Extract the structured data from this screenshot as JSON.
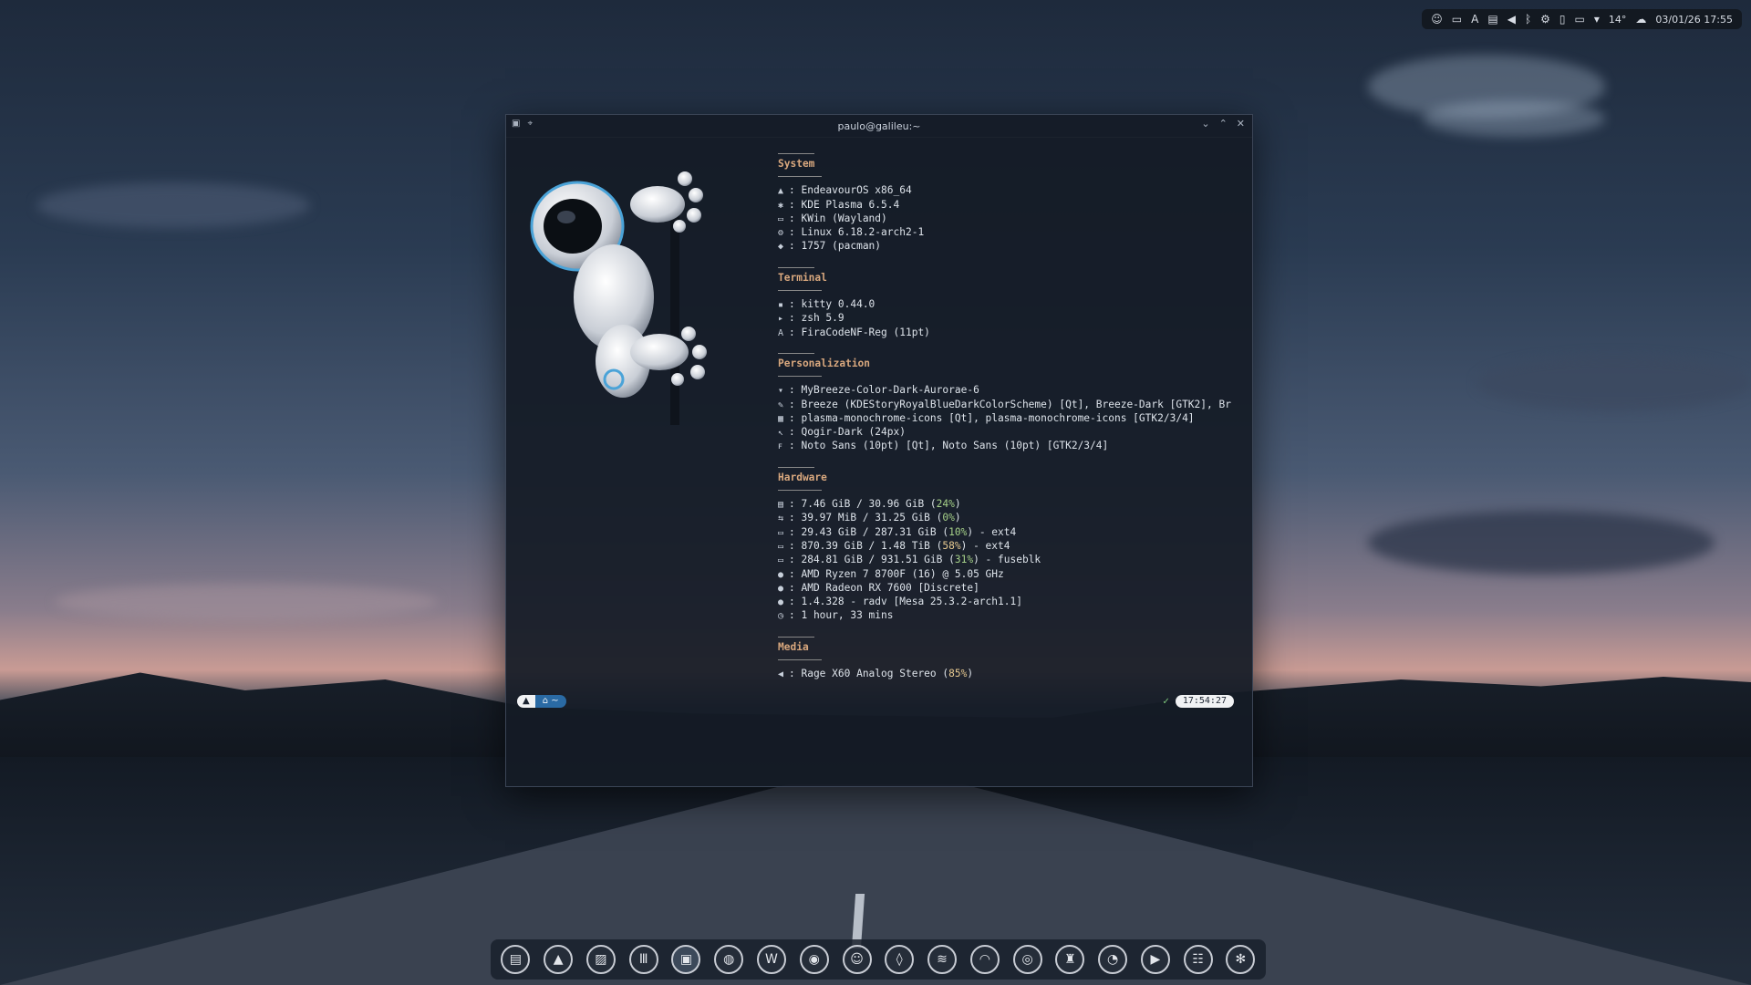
{
  "panel": {
    "icons": [
      "discord-icon",
      "battery-icon",
      "font-icon",
      "clipboard-icon",
      "volume-icon",
      "bluetooth-icon",
      "network-icon",
      "sd-card-icon",
      "display-icon",
      "chevron-down-icon"
    ],
    "weather_temp": "14°",
    "weather_icon": "cloud-icon",
    "datetime": "03/01/26 17:55"
  },
  "terminal": {
    "title": "paulo@galileu:~",
    "sections": [
      {
        "title": "System",
        "rows": [
          {
            "icon": "▲",
            "text": ": EndeavourOS x86_64"
          },
          {
            "icon": "✱",
            "text": ": KDE Plasma 6.5.4"
          },
          {
            "icon": "▭",
            "text": ": KWin (Wayland)"
          },
          {
            "icon": "⚙",
            "text": ": Linux 6.18.2-arch2-1"
          },
          {
            "icon": "◆",
            "text": ": 1757 (pacman)"
          }
        ]
      },
      {
        "title": "Terminal",
        "rows": [
          {
            "icon": "▪",
            "text": ": kitty 0.44.0"
          },
          {
            "icon": "▸",
            "text": ": zsh 5.9"
          },
          {
            "icon": "A",
            "text": ": FiraCodeNF-Reg (11pt)"
          }
        ]
      },
      {
        "title": "Personalization",
        "rows": [
          {
            "icon": "▾",
            "text": ": MyBreeze-Color-Dark-Aurorae-6"
          },
          {
            "icon": "✎",
            "text": ": Breeze (KDEStoryRoyalBlueDarkColorScheme) [Qt], Breeze-Dark [GTK2], Br"
          },
          {
            "icon": "▦",
            "text": ": plasma-monochrome-icons [Qt], plasma-monochrome-icons [GTK2/3/4]"
          },
          {
            "icon": "↖",
            "text": ": Qogir-Dark (24px)"
          },
          {
            "icon": "ꜰ",
            "text": ": Noto Sans (10pt) [Qt], Noto Sans (10pt) [GTK2/3/4]"
          }
        ]
      },
      {
        "title": "Hardware",
        "rows": [
          {
            "icon": "▤",
            "pre": ": 7.46 GiB / 30.96 GiB (",
            "pct": "24%",
            "post": ")",
            "warn": false
          },
          {
            "icon": "⇆",
            "pre": ": 39.97 MiB / 31.25 GiB (",
            "pct": "0%",
            "post": ")",
            "warn": false
          },
          {
            "icon": "▭",
            "pre": ": 29.43 GiB / 287.31 GiB (",
            "pct": "10%",
            "post": ") - ext4",
            "warn": false
          },
          {
            "icon": "▭",
            "pre": ": 870.39 GiB / 1.48 TiB (",
            "pct": "58%",
            "post": ") - ext4",
            "warn": true
          },
          {
            "icon": "▭",
            "pre": ": 284.81 GiB / 931.51 GiB (",
            "pct": "31%",
            "post": ") - fuseblk",
            "warn": false
          },
          {
            "icon": "●",
            "text": ": AMD Ryzen 7 8700F (16) @ 5.05 GHz"
          },
          {
            "icon": "●",
            "text": ": AMD Radeon RX 7600 [Discrete]"
          },
          {
            "icon": "●",
            "text": ": 1.4.328 - radv [Mesa 25.3.2-arch1.1]"
          },
          {
            "icon": "◷",
            "text": ": 1 hour, 33 mins"
          }
        ]
      },
      {
        "title": "Media",
        "rows": [
          {
            "icon": "◀",
            "pre": ": Rage X60 Analog Stereo (",
            "pct": "85%",
            "post": ")",
            "warn": true
          }
        ]
      }
    ],
    "prompt": {
      "os_glyph": "▲",
      "path": "⌂ ~",
      "status": "✓",
      "time": "17:54:27"
    }
  },
  "dock": {
    "items": [
      {
        "name": "file-manager-icon",
        "glyph": "▤"
      },
      {
        "name": "endeavouros-icon",
        "glyph": "▲"
      },
      {
        "name": "image-viewer-icon",
        "glyph": "▨"
      },
      {
        "name": "library-icon",
        "glyph": "Ⅲ"
      },
      {
        "name": "terminal-icon",
        "glyph": "▣",
        "active": true
      },
      {
        "name": "tor-icon",
        "glyph": "◍"
      },
      {
        "name": "browser-w-icon",
        "glyph": "W"
      },
      {
        "name": "firefox-icon",
        "glyph": "◉"
      },
      {
        "name": "discord-icon",
        "glyph": "☺"
      },
      {
        "name": "droplet-icon",
        "glyph": "◊"
      },
      {
        "name": "spotify-icon",
        "glyph": "≋"
      },
      {
        "name": "headphones-icon",
        "glyph": "◠"
      },
      {
        "name": "globe-icon",
        "glyph": "◎"
      },
      {
        "name": "shield-icon",
        "glyph": "♜"
      },
      {
        "name": "steam-icon",
        "glyph": "◔"
      },
      {
        "name": "video-camera-icon",
        "glyph": "▶"
      },
      {
        "name": "mixer-icon",
        "glyph": "☷"
      },
      {
        "name": "kde-settings-icon",
        "glyph": "✻"
      }
    ]
  }
}
